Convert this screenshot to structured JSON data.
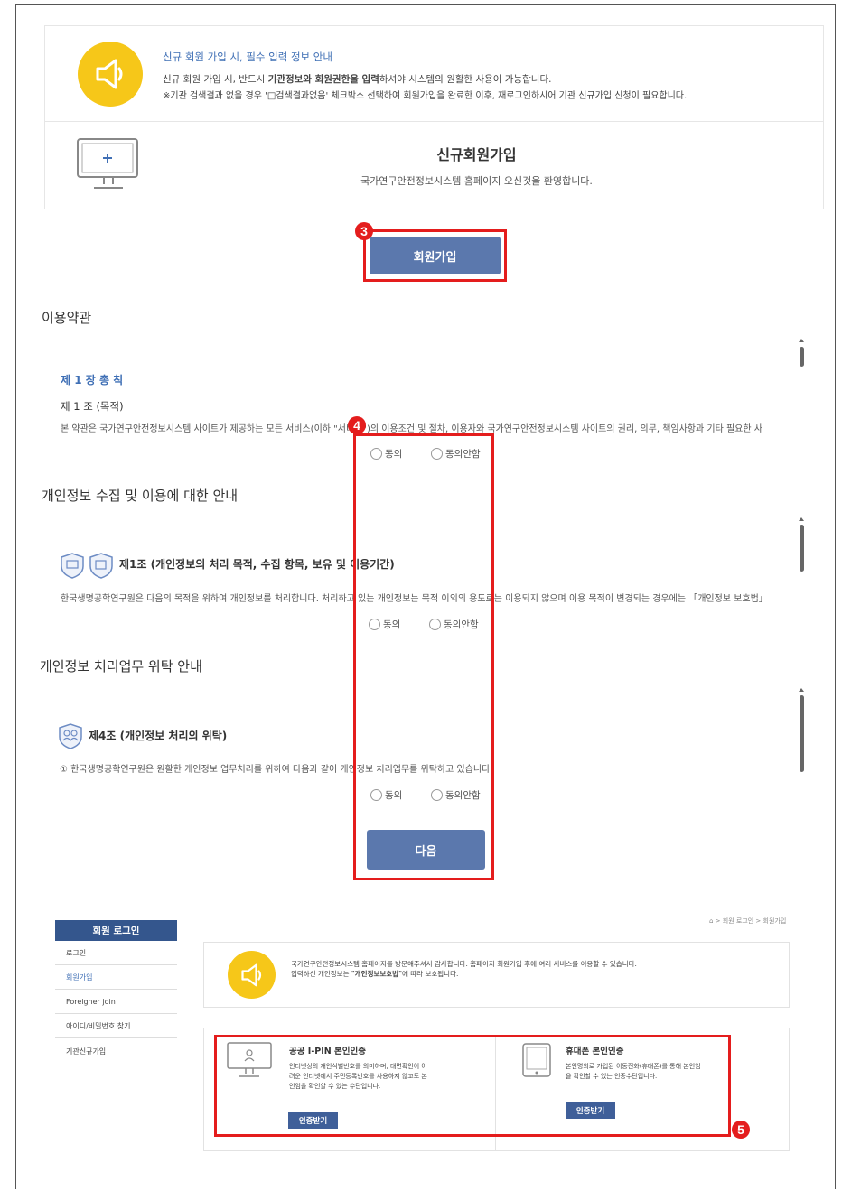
{
  "notice": {
    "title": "신규 회원 가입 시, 필수 입력 정보 안내",
    "line1_pre": "신규 회원 가입 시, 반드시 ",
    "line1_bold": "기관정보와 회원권한을 입력",
    "line1_post": "하셔야 시스템의 원활한 사용이 가능합니다.",
    "line2": "※기관 검색결과 없을 경우 '□검색결과없음' 체크박스 선택하여 회원가입을 완료한 이후, 재로그인하시어 기관 신규가입 신청이 필요합니다."
  },
  "signup": {
    "heading": "신규회원가입",
    "welcome": "국가연구안전정보시스템 홈페이지 오신것을 환영합니다.",
    "button_label": "회원가입",
    "badge": "3"
  },
  "terms": {
    "title": "이용약관",
    "chapter": "제 1 장 총 칙",
    "article": "제 1 조 (목적)",
    "body": "본 약관은 국가연구안전정보시스템 사이트가 제공하는 모든 서비스(이하 \"서비스\")의 이용조건 및 절차, 이용자와 국가연구안전정보시스템 사이트의 권리, 의무, 책임사항과 기타 필요한 사",
    "agree": "동의",
    "disagree": "동의안함",
    "badge": "4"
  },
  "privacy": {
    "title": "개인정보 수집 및 이용에 대한 안내",
    "article": "제1조 (개인정보의 처리 목적, 수집 항목, 보유 및 이용기간)",
    "body": "한국생명공학연구원은 다음의 목적을 위하여 개인정보를 처리합니다. 처리하고 있는 개인정보는 목적 이외의 용도로는 이용되지 않으며 이용 목적이 변경되는 경우에는 「개인정보 보호법」",
    "agree": "동의",
    "disagree": "동의안함"
  },
  "consign": {
    "title": "개인정보 처리업무 위탁 안내",
    "article": "제4조 (개인정보 처리의 위탁)",
    "body": "① 한국생명공학연구원은 원활한 개인정보 업무처리를 위하여 다음과 같이 개인정보 처리업무를 위탁하고 있습니다.",
    "agree": "동의",
    "disagree": "동의안함"
  },
  "next_button": "다음",
  "sidebar": {
    "title": "회원 로그인",
    "items": [
      "로그인",
      "회원가입",
      "Foreigner join",
      "아이디/비밀번호 찾기",
      "기관신규가입"
    ]
  },
  "breadcrumb": "⌂ > 회원 로그인 > 회원가입",
  "welcome_box": {
    "line1": "국가연구안전정보시스템 홈페이지를 방문해주셔서 감사합니다. 홈페이지 회원가입 후에 여러 서비스를 이용할 수 있습니다.",
    "line2_pre": "입력하신 개인정보는 ",
    "line2_bold": "\"개인정보보호법\"",
    "line2_post": "에 따라 보호됩니다."
  },
  "auth": {
    "ipin": {
      "title": "공공 I-PIN 본인인증",
      "desc": "인터넷상의 개인식별번호를 의미하며, 대면확인이 어려운 인터넷에서 주민등록번호를 사용하지 않고도 본인임을 확인할 수 있는 수단입니다.",
      "button": "인증받기"
    },
    "phone": {
      "title": "휴대폰 본인인증",
      "desc": "본인명의로 가입된 이동전화(휴대폰)를 통해 본인임을 확인할 수 있는 인증수단입니다.",
      "button": "인증받기"
    },
    "badge": "5"
  }
}
